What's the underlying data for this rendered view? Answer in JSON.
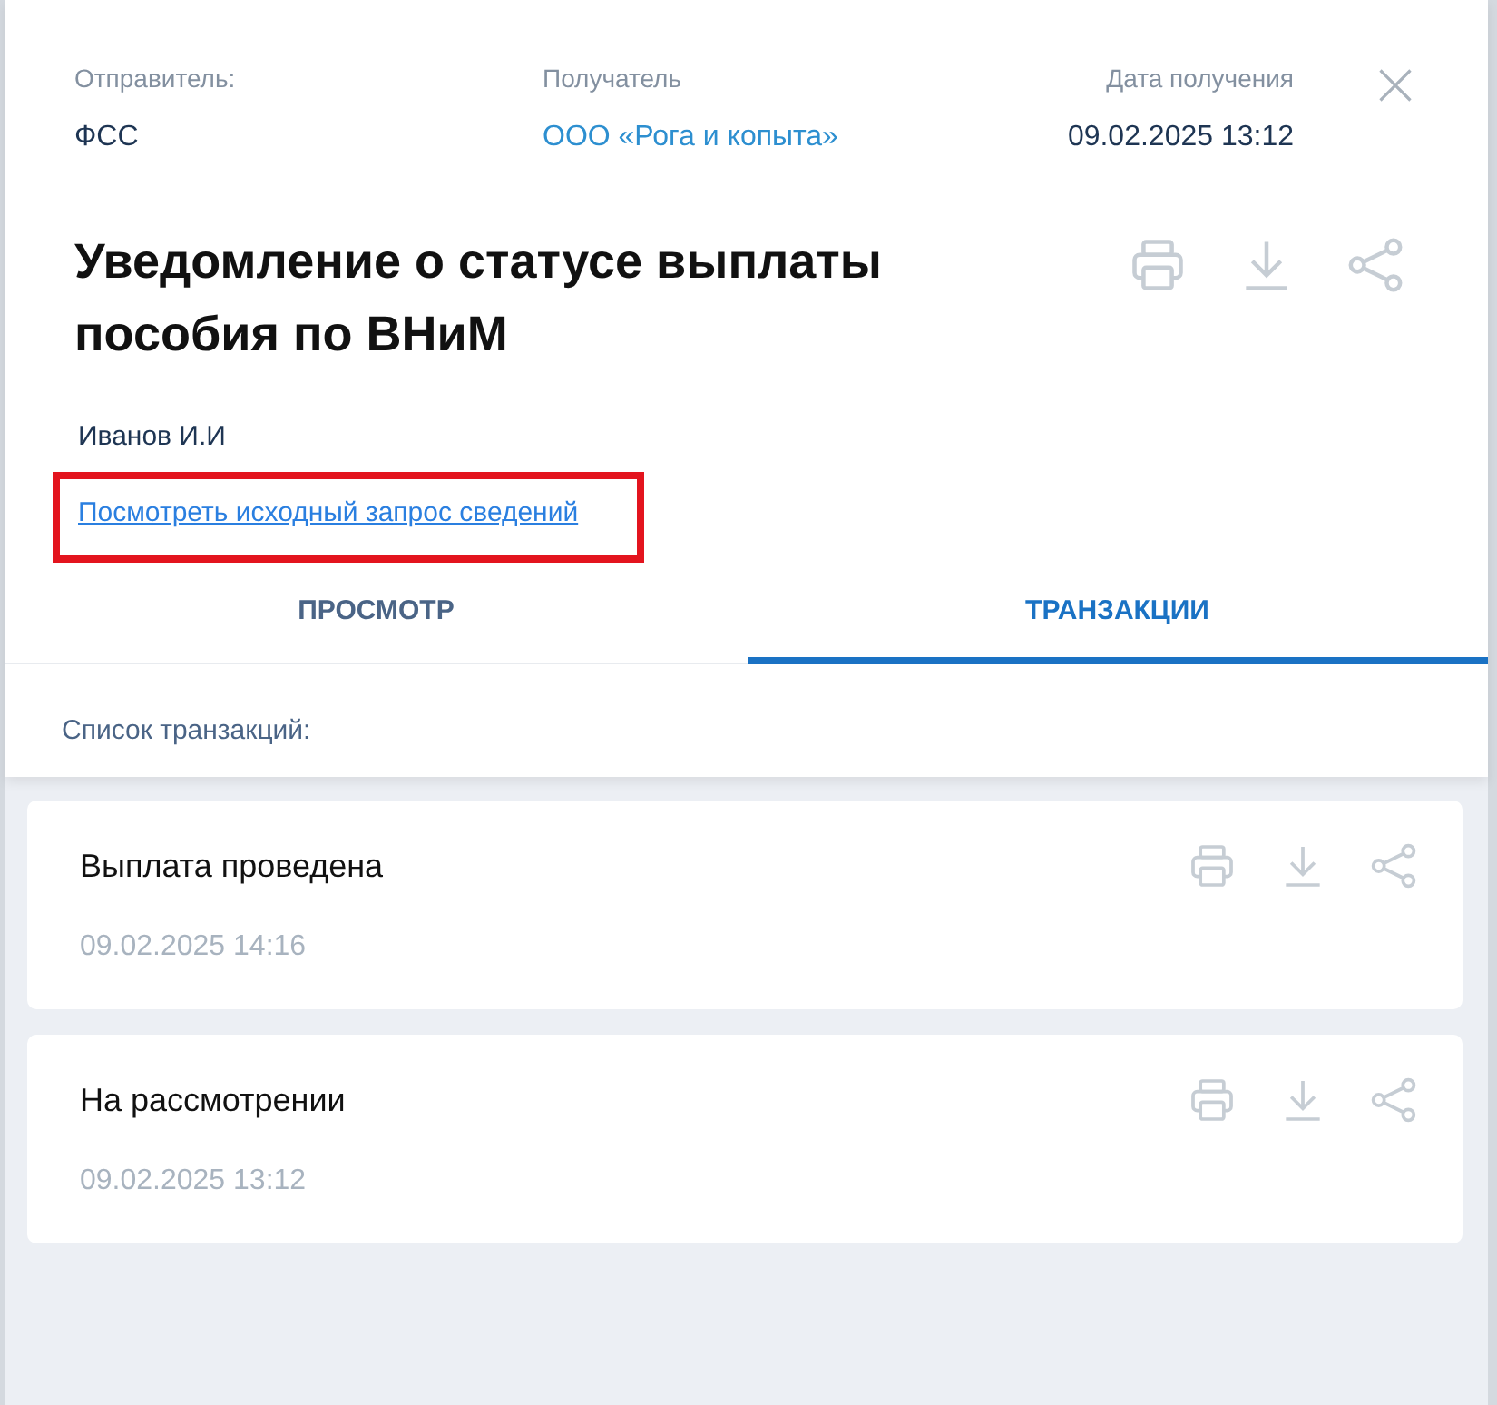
{
  "header": {
    "fields": [
      {
        "label": "Отправитель:",
        "value": "ФСС",
        "kind": "plain"
      },
      {
        "label": "Получатель",
        "value": "ООО «Рога и копыта»",
        "kind": "link"
      },
      {
        "label": "Дата получения",
        "value": "09.02.2025 13:12",
        "kind": "date"
      }
    ]
  },
  "title": "Уведомление о статусе выплаты пособия по ВНиМ",
  "author": "Иванов И.И",
  "source_link": {
    "text": "Посмотреть исходный запрос сведений",
    "highlighted": true
  },
  "tabs": [
    {
      "label": "ПРОСМОТР",
      "selected": false
    },
    {
      "label": "ТРАНЗАКЦИИ",
      "selected": true
    }
  ],
  "list_label": "Список транзакций:",
  "transactions": [
    {
      "title": "Выплата проведена",
      "date": "09.02.2025 14:16"
    },
    {
      "title": "На рассмотрении",
      "date": "09.02.2025 13:12"
    }
  ]
}
